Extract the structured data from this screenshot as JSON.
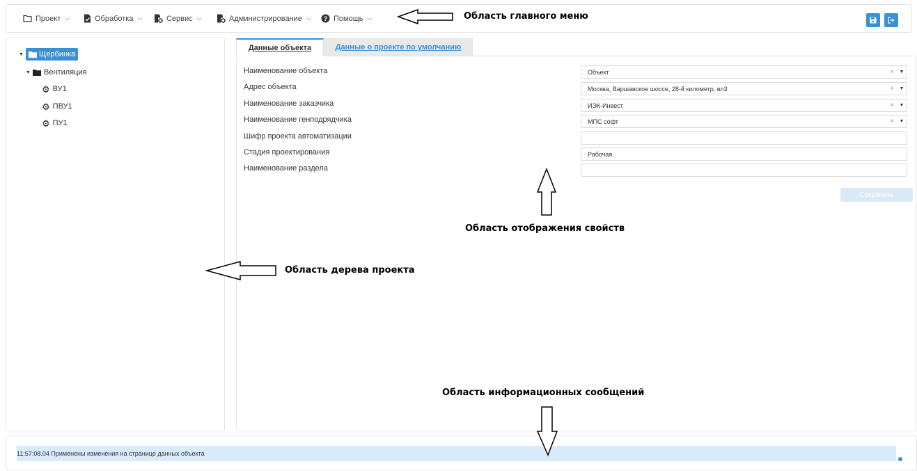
{
  "menu": {
    "project": "Проект",
    "processing": "Обработка",
    "service": "Сервис",
    "admin": "Администрирование",
    "help": "Помощь"
  },
  "toolbar": {
    "save_icon": "floppy-disk-icon",
    "exit_icon": "sign-out-icon",
    "accent": "#3a8fd6"
  },
  "tree": {
    "root": "Щербинка",
    "folder": "Вентиляция",
    "items": [
      "ВУ1",
      "ПВУ1",
      "ПУ1"
    ]
  },
  "tabs": {
    "active": "Данные объекта",
    "inactive": "Данные о проекте по умолчанию"
  },
  "props": [
    {
      "label": "Наименование объекта",
      "value": "Объект",
      "type": "select"
    },
    {
      "label": "Адрес объекта",
      "value": "Москва, Варшавское шоссе, 28-й километр, вл3",
      "type": "select"
    },
    {
      "label": "Наименование заказчика",
      "value": "ИЭК-Инвест",
      "type": "select"
    },
    {
      "label": "Наименование генподрядчика",
      "value": "МПС софт",
      "type": "select"
    },
    {
      "label": "Шифр проекта автоматизации",
      "value": "",
      "type": "text"
    },
    {
      "label": "Стадия проектирования",
      "value": "Рабочая",
      "type": "text"
    },
    {
      "label": "Наименование раздела",
      "value": "",
      "type": "text"
    }
  ],
  "save_button": "Сохранить",
  "clear_glyph": "×",
  "message": "11:57:08.04 Применены изменения на странице данных объекта",
  "annotations": {
    "menu": "Область главного меню",
    "props": "Область отображения свойств",
    "tree": "Область дерева проекта",
    "messages": "Область информационных сообщений"
  }
}
